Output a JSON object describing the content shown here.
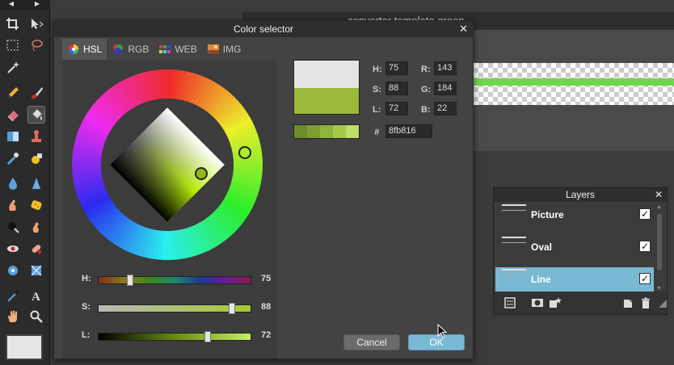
{
  "document": {
    "title": "converter template green"
  },
  "toolbar": {
    "tools": [
      {
        "name": "crop-icon"
      },
      {
        "name": "move-icon"
      },
      {
        "name": "marquee-icon"
      },
      {
        "name": "lasso-icon"
      },
      {
        "name": "magic-wand-icon"
      },
      {
        "name": "pencil-icon"
      },
      {
        "name": "brush-icon"
      },
      {
        "name": "eraser-icon"
      },
      {
        "name": "paint-bucket-icon"
      },
      {
        "name": "gradient-icon"
      },
      {
        "name": "stamp-icon"
      },
      {
        "name": "color-picker-icon"
      },
      {
        "name": "shape-icon"
      },
      {
        "name": "drop-icon"
      },
      {
        "name": "sharpen-icon"
      },
      {
        "name": "smudge-icon"
      },
      {
        "name": "sponge-icon"
      },
      {
        "name": "burn-icon"
      },
      {
        "name": "dodge-icon"
      },
      {
        "name": "red-eye-icon"
      },
      {
        "name": "spot-heal-icon"
      },
      {
        "name": "bloat-icon"
      },
      {
        "name": "pinch-icon"
      },
      {
        "name": "eyedropper-icon"
      },
      {
        "name": "text-icon"
      },
      {
        "name": "hand-icon"
      },
      {
        "name": "zoom-icon"
      }
    ],
    "foreground_color": "#e6e6e6"
  },
  "dialog": {
    "title": "Color selector",
    "close": "✕",
    "tabs": [
      {
        "label": "HSL",
        "active": true
      },
      {
        "label": "RGB",
        "active": false
      },
      {
        "label": "WEB",
        "active": false
      },
      {
        "label": "IMG",
        "active": false
      }
    ],
    "sliders": [
      {
        "label": "H:",
        "value": "75",
        "fraction": 0.21
      },
      {
        "label": "S:",
        "value": "88",
        "fraction": 0.88
      },
      {
        "label": "L:",
        "value": "72",
        "fraction": 0.72
      }
    ],
    "fields": {
      "h_label": "H:",
      "h": "75",
      "s_label": "S:",
      "s": "88",
      "l_label": "L:",
      "l": "72",
      "r_label": "R:",
      "r": "143",
      "g_label": "G:",
      "g": "184",
      "b_label": "B:",
      "b": "22",
      "hex_label": "#",
      "hex": "8fb816"
    },
    "preview": {
      "old_color": "#e4e4e4",
      "new_color": "#9ab93a"
    },
    "shades": [
      "#6f8c2c",
      "#7e9e33",
      "#8fb33d",
      "#a4c84a",
      "#bedd6a"
    ],
    "cancel": "Cancel",
    "ok": "OK"
  },
  "layers": {
    "title": "Layers",
    "close": "✕",
    "items": [
      {
        "name": "Picture",
        "visible": true,
        "selected": false
      },
      {
        "name": "Oval",
        "visible": true,
        "selected": false
      },
      {
        "name": "Line",
        "visible": true,
        "selected": true
      }
    ],
    "check": "✓"
  },
  "colors": {
    "accent": "#7ab9d4",
    "line": "#74d44c"
  }
}
